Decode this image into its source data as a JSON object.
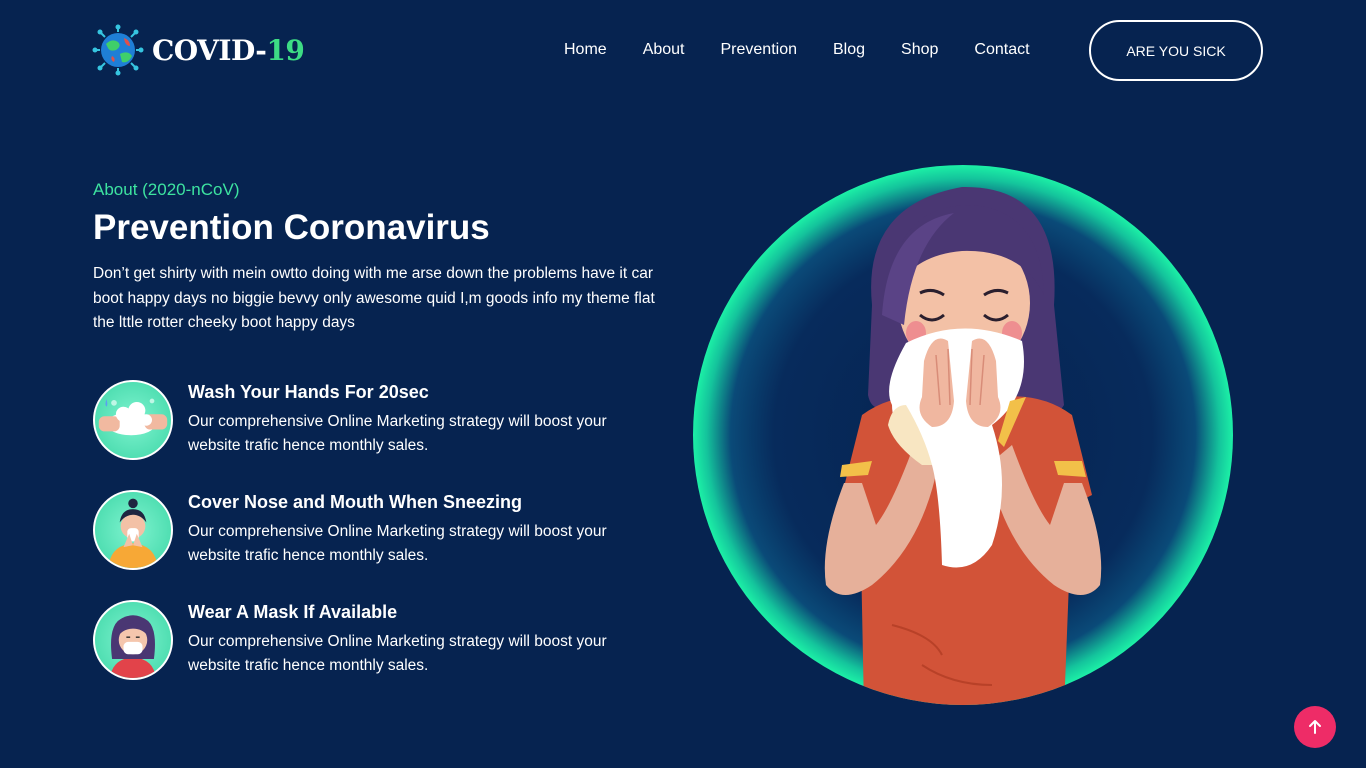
{
  "brand": {
    "name": "COVID-",
    "number": "19",
    "accent": "#3ddc84"
  },
  "nav": {
    "items": [
      {
        "label": "Home"
      },
      {
        "label": "About"
      },
      {
        "label": "Prevention"
      },
      {
        "label": "Blog"
      },
      {
        "label": "Shop"
      },
      {
        "label": "Contact"
      }
    ],
    "cta_label": "ARE YOU SICK"
  },
  "about": {
    "eyebrow": "About (2020-nCoV)",
    "title": "Prevention Coronavirus",
    "description": "Don’t get shirty with mein owtto doing with me arse down the problems have it car boot happy days no biggie bevvy only awesome quid I,m goods info my theme flat the lttle rotter cheeky boot happy days"
  },
  "features": [
    {
      "icon": "wash-hands-icon",
      "title": "Wash Your Hands For 20sec",
      "description": "Our comprehensive Online Marketing strategy will boost your website trafic hence monthly sales."
    },
    {
      "icon": "sneeze-cover-icon",
      "title": "Cover Nose and Mouth When Sneezing",
      "description": "Our comprehensive Online Marketing strategy will boost your website trafic hence monthly sales."
    },
    {
      "icon": "face-mask-icon",
      "title": "Wear A Mask If Available",
      "description": "Our comprehensive Online Marketing strategy will boost your website trafic hence monthly sales."
    }
  ],
  "colors": {
    "background": "#062350",
    "eyebrow": "#3de3a0",
    "glow": "#19f0a0",
    "scroll_button": "#ee2c67"
  },
  "scroll_top_icon": "arrow-up-icon"
}
